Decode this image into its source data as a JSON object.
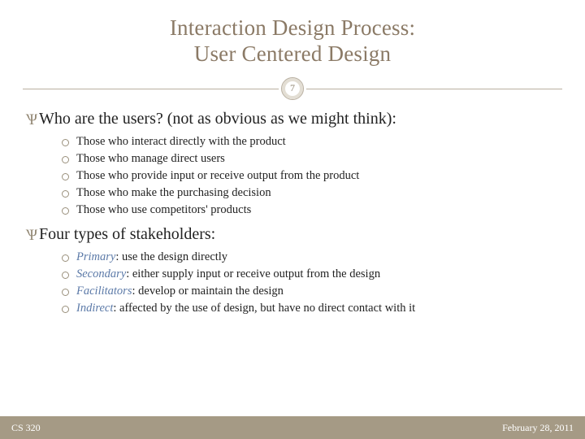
{
  "title_line1": "Interaction Design Process:",
  "title_line2": "User Centered Design",
  "slide_number": "7",
  "sections": [
    {
      "heading": "Who are the users? (not as obvious as we might think):",
      "items": [
        {
          "text": "Those who interact directly with the product"
        },
        {
          "text": "Those who manage direct users"
        },
        {
          "text": "Those who provide input or receive output from the product"
        },
        {
          "text": "Those who make the purchasing decision"
        },
        {
          "text": "Those who use competitors' products"
        }
      ]
    },
    {
      "heading": "Four types of stakeholders:",
      "items": [
        {
          "em": "Primary",
          "text": ": use the design directly"
        },
        {
          "em": "Secondary",
          "text": ": either supply input or receive output from the design"
        },
        {
          "em": "Facilitators",
          "text": ": develop or maintain the design"
        },
        {
          "em": "Indirect",
          "text": ": affected by the use of design, but have no direct contact with it"
        }
      ]
    }
  ],
  "footer": {
    "left": "CS 320",
    "right": "February 28, 2011"
  }
}
